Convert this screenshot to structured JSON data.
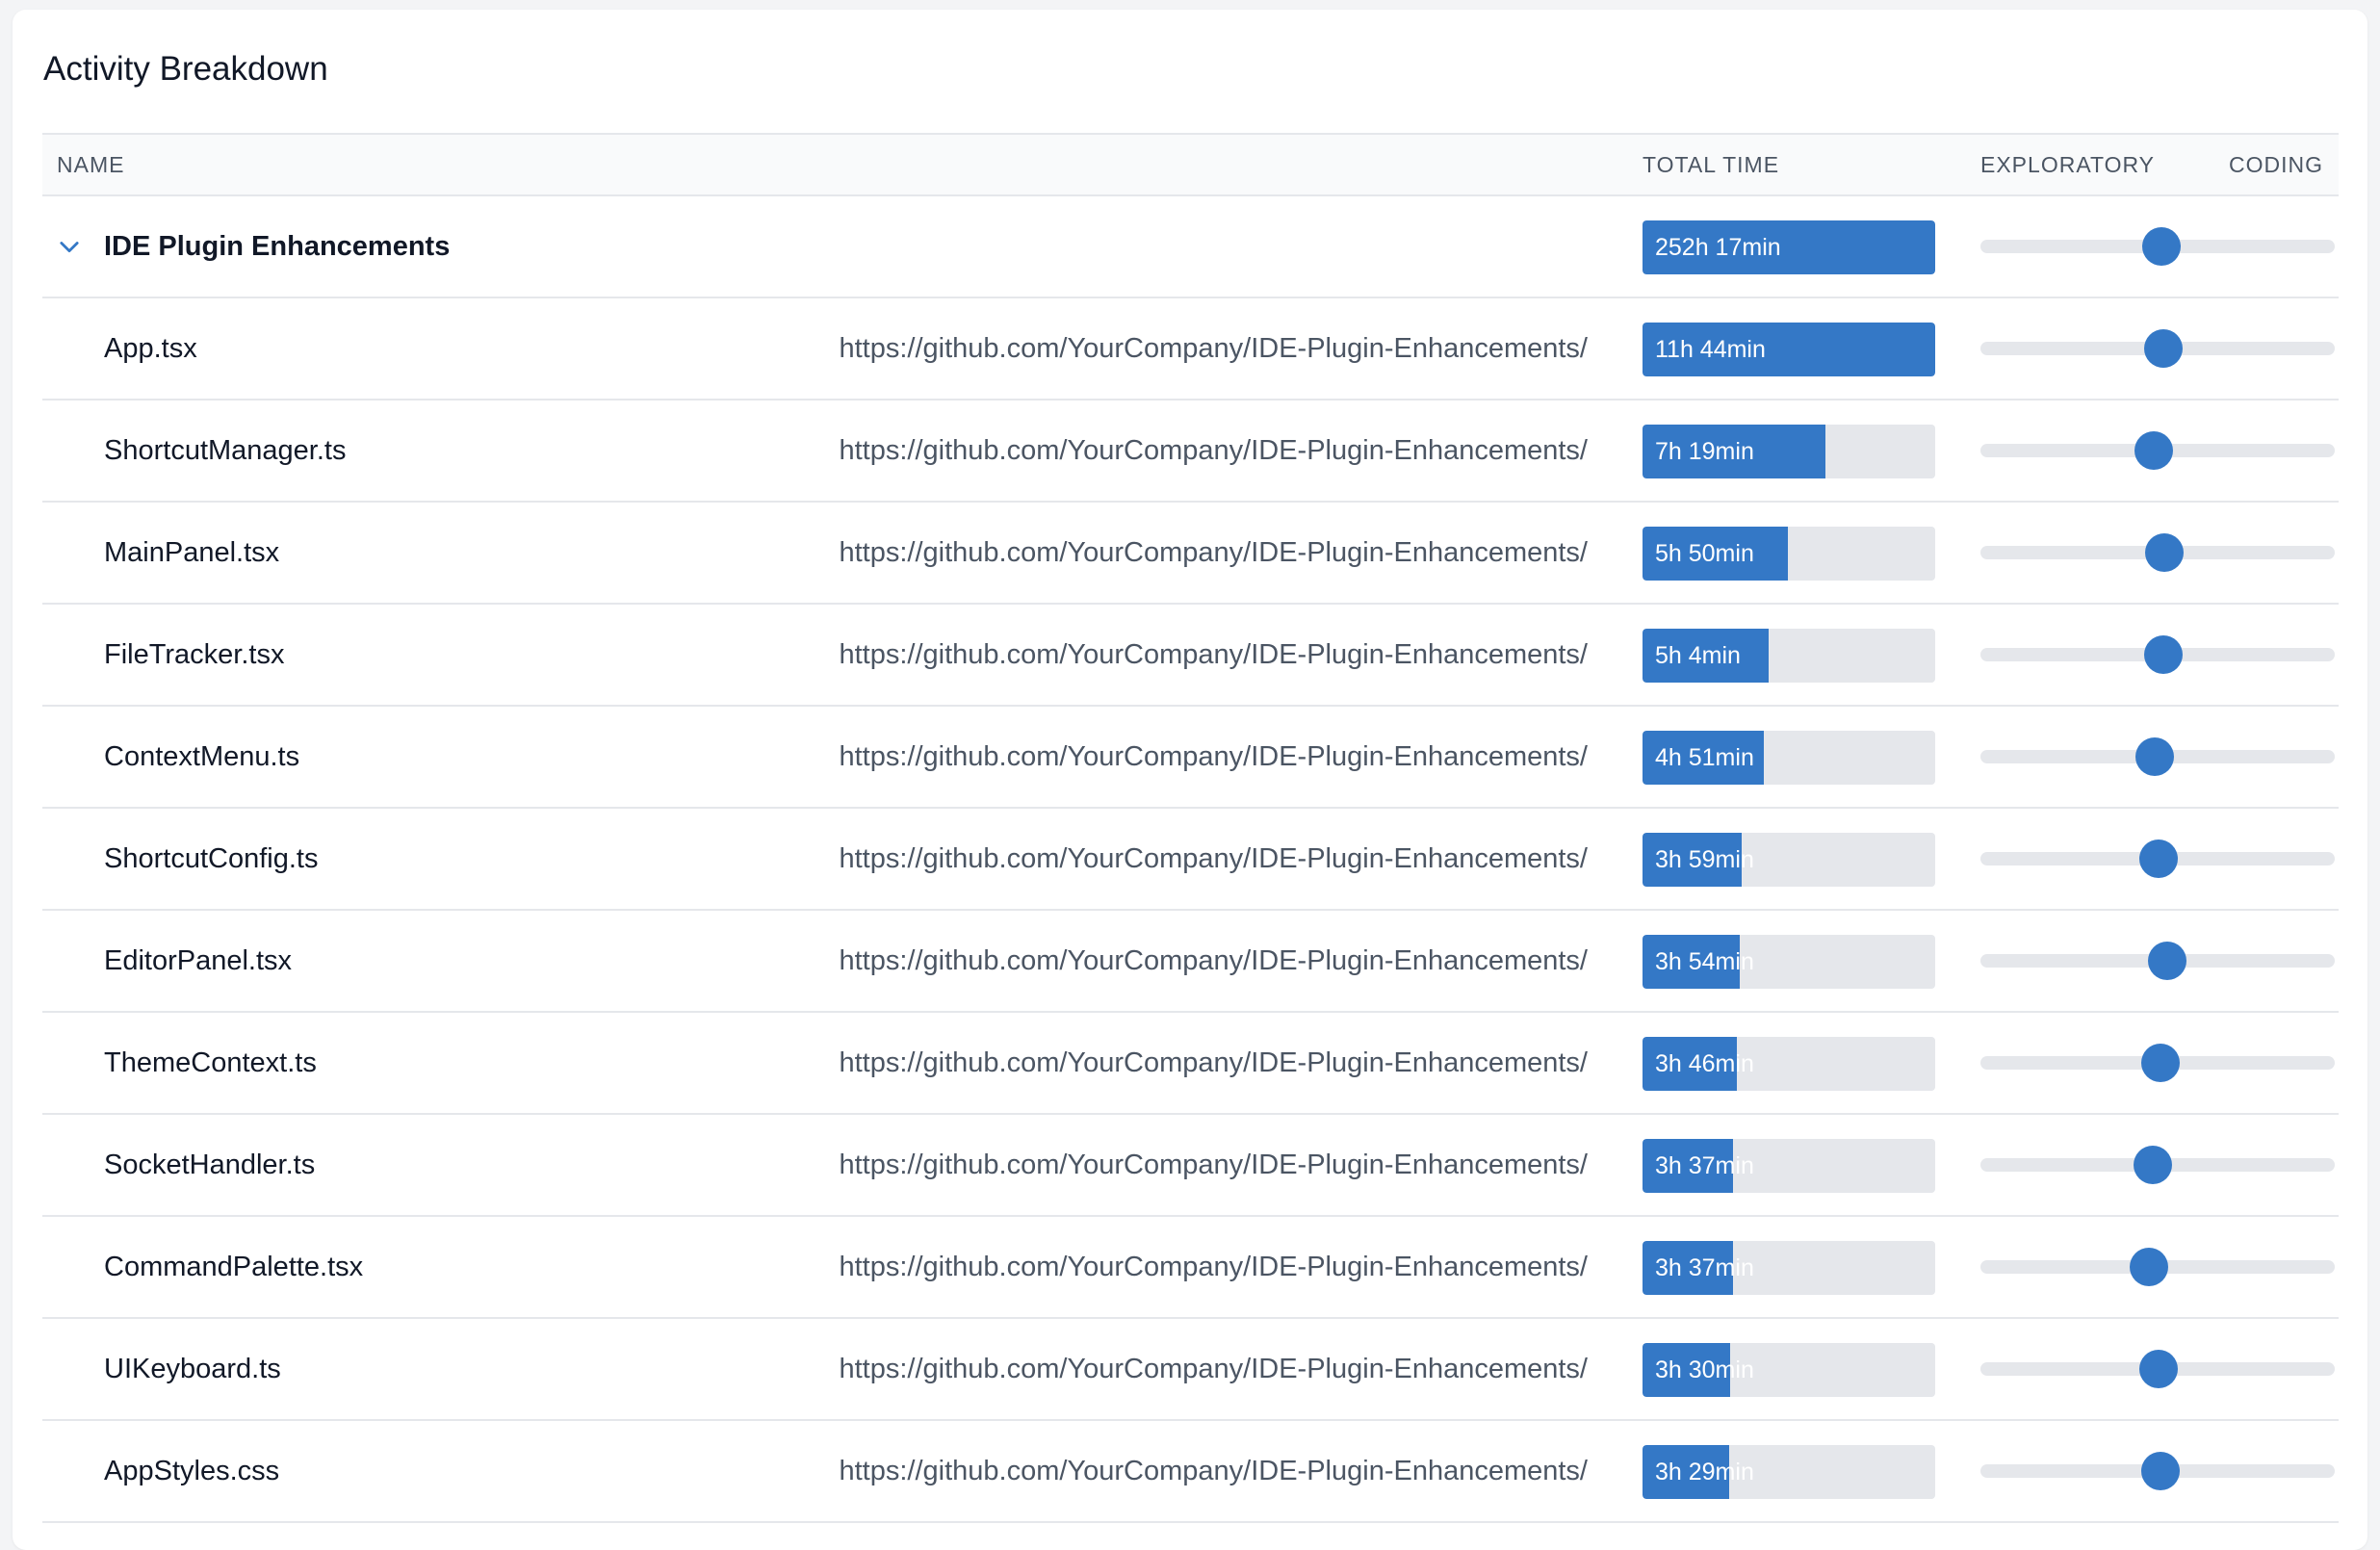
{
  "title": "Activity Breakdown",
  "columns": {
    "name": "NAME",
    "total_time": "TOTAL TIME",
    "exploratory": "EXPLORATORY",
    "coding": "CODING"
  },
  "colors": {
    "accent": "#3478c6",
    "track": "#e5e7eb",
    "header_bg": "#f9fafb"
  },
  "icons": {
    "expand": "chevron-down-icon"
  },
  "rows": [
    {
      "name": "IDE Plugin Enhancements",
      "url": "",
      "time": "252h 17min",
      "time_fraction": 1.0,
      "balance": 0.51,
      "is_group": true
    },
    {
      "name": "App.tsx",
      "url": "https://github.com/YourCompany/IDE-Plugin-Enhancements/",
      "time": "11h 44min",
      "time_fraction": 1.0,
      "balance": 0.515
    },
    {
      "name": "ShortcutManager.ts",
      "url": "https://github.com/YourCompany/IDE-Plugin-Enhancements/",
      "time": "7h 19min",
      "time_fraction": 0.624,
      "balance": 0.49
    },
    {
      "name": "MainPanel.tsx",
      "url": "https://github.com/YourCompany/IDE-Plugin-Enhancements/",
      "time": "5h 50min",
      "time_fraction": 0.497,
      "balance": 0.518
    },
    {
      "name": "FileTracker.tsx",
      "url": "https://github.com/YourCompany/IDE-Plugin-Enhancements/",
      "time": "5h 4min",
      "time_fraction": 0.432,
      "balance": 0.515
    },
    {
      "name": "ContextMenu.ts",
      "url": "https://github.com/YourCompany/IDE-Plugin-Enhancements/",
      "time": "4h 51min",
      "time_fraction": 0.413,
      "balance": 0.493
    },
    {
      "name": "ShortcutConfig.ts",
      "url": "https://github.com/YourCompany/IDE-Plugin-Enhancements/",
      "time": "3h 59min",
      "time_fraction": 0.34,
      "balance": 0.504
    },
    {
      "name": "EditorPanel.tsx",
      "url": "https://github.com/YourCompany/IDE-Plugin-Enhancements/",
      "time": "3h 54min",
      "time_fraction": 0.332,
      "balance": 0.528
    },
    {
      "name": "ThemeContext.ts",
      "url": "https://github.com/YourCompany/IDE-Plugin-Enhancements/",
      "time": "3h 46min",
      "time_fraction": 0.321,
      "balance": 0.509
    },
    {
      "name": "SocketHandler.ts",
      "url": "https://github.com/YourCompany/IDE-Plugin-Enhancements/",
      "time": "3h 37min",
      "time_fraction": 0.308,
      "balance": 0.486
    },
    {
      "name": "CommandPalette.tsx",
      "url": "https://github.com/YourCompany/IDE-Plugin-Enhancements/",
      "time": "3h 37min",
      "time_fraction": 0.308,
      "balance": 0.475
    },
    {
      "name": "UIKeyboard.ts",
      "url": "https://github.com/YourCompany/IDE-Plugin-Enhancements/",
      "time": "3h 30min",
      "time_fraction": 0.298,
      "balance": 0.504
    },
    {
      "name": "AppStyles.css",
      "url": "https://github.com/YourCompany/IDE-Plugin-Enhancements/",
      "time": "3h 29min",
      "time_fraction": 0.297,
      "balance": 0.509
    }
  ]
}
